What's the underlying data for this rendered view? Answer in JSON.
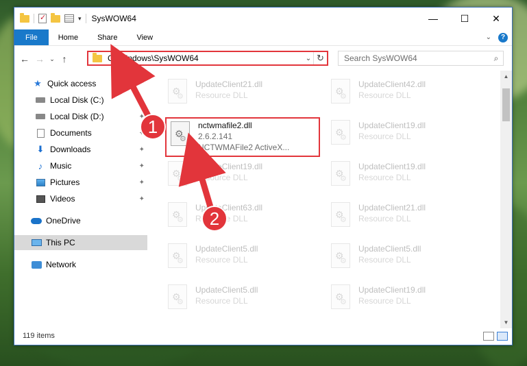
{
  "window": {
    "title": "SysWOW64",
    "controls": {
      "minimize": "—",
      "maximize": "☐",
      "close": "✕"
    }
  },
  "ribbon": {
    "tabs": [
      "File",
      "Home",
      "Share",
      "View"
    ]
  },
  "nav": {
    "back": "←",
    "forward": "→",
    "recent": "⌄",
    "up": "↑",
    "address": "C:\\Windows\\SysWOW64",
    "search_placeholder": "Search SysWOW64"
  },
  "sidebar": {
    "quick_access": "Quick access",
    "items": [
      {
        "label": "Local Disk (C:)",
        "icon": "drive-icon"
      },
      {
        "label": "Local Disk (D:)",
        "icon": "drive-icon"
      },
      {
        "label": "Documents",
        "icon": "documents-icon"
      },
      {
        "label": "Downloads",
        "icon": "downloads-icon"
      },
      {
        "label": "Music",
        "icon": "music-icon"
      },
      {
        "label": "Pictures",
        "icon": "pictures-icon"
      },
      {
        "label": "Videos",
        "icon": "videos-icon"
      }
    ],
    "onedrive": "OneDrive",
    "this_pc": "This PC",
    "network": "Network"
  },
  "files": {
    "left": [
      {
        "name": "UpdateClient21.dll",
        "type": "Resource DLL"
      },
      {
        "name": "UpdateClient19.dll",
        "type": "Resource DLL"
      },
      {
        "name": "UpdateClient63.dll",
        "type": "Resource DLL"
      },
      {
        "name": "UpdateClient5.dll",
        "type": "Resource DLL"
      },
      {
        "name": "UpdateClient5.dll",
        "type": "Resource DLL"
      }
    ],
    "right": [
      {
        "name": "UpdateClient42.dll",
        "type": "Resource DLL"
      },
      {
        "name": "UpdateClient19.dll",
        "type": "Resource DLL"
      },
      {
        "name": "UpdateClient19.dll",
        "type": "Resource DLL"
      },
      {
        "name": "UpdateClient21.dll",
        "type": "Resource DLL"
      },
      {
        "name": "UpdateClient5.dll",
        "type": "Resource DLL"
      },
      {
        "name": "UpdateClient19.dll",
        "type": "Resource DLL"
      }
    ],
    "highlighted": {
      "name": "nctwmafile2.dll",
      "version": "2.6.2.141",
      "description": "NCTWMAFile2 ActiveX..."
    }
  },
  "status": {
    "items": "119 items"
  },
  "annotations": {
    "step1": "1",
    "step2": "2",
    "accent": "#e2353b"
  }
}
